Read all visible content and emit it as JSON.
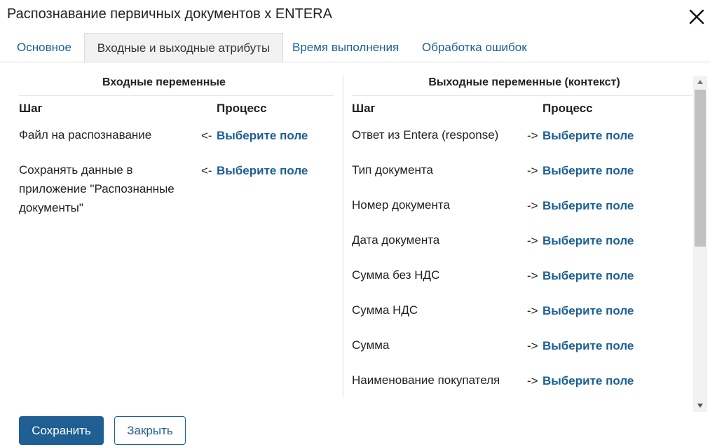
{
  "dialog": {
    "title": "Распознавание первичных документов  x ENTERA",
    "close_icon": "close-icon"
  },
  "tabs": [
    {
      "label": "Основное",
      "active": false
    },
    {
      "label": "Входные и выходные атрибуты",
      "active": true
    },
    {
      "label": "Время выполнения",
      "active": false
    },
    {
      "label": "Обработка ошибок",
      "active": false
    }
  ],
  "input": {
    "title": "Входные переменные",
    "col_step": "Шаг",
    "col_process": "Процесс",
    "rows": [
      {
        "step": "Файл на распознавание",
        "arrow": "<-",
        "field": "Выберите поле"
      },
      {
        "step": "Сохранять данные в приложение \"Распознанные документы\"",
        "arrow": "<-",
        "field": "Выберите поле"
      }
    ]
  },
  "output": {
    "title": "Выходные переменные (контекст)",
    "col_step": "Шаг",
    "col_process": "Процесс",
    "rows": [
      {
        "step": "Ответ из Entera (response)",
        "arrow": "->",
        "field": "Выберите поле"
      },
      {
        "step": "Тип документа",
        "arrow": "->",
        "field": "Выберите поле"
      },
      {
        "step": "Номер документа",
        "arrow": "->",
        "field": "Выберите поле"
      },
      {
        "step": "Дата документа",
        "arrow": "->",
        "field": "Выберите поле"
      },
      {
        "step": "Сумма без НДС",
        "arrow": "->",
        "field": "Выберите поле"
      },
      {
        "step": "Сумма НДС",
        "arrow": "->",
        "field": "Выберите поле"
      },
      {
        "step": "Сумма",
        "arrow": "->",
        "field": "Выберите поле"
      },
      {
        "step": "Наименование покупателя",
        "arrow": "->",
        "field": "Выберите поле"
      }
    ]
  },
  "footer": {
    "save_label": "Сохранить",
    "close_label": "Закрыть"
  },
  "colors": {
    "accent": "#1f5f93",
    "link": "#1c5f93",
    "tab_active_bg": "#f2f2f2"
  }
}
